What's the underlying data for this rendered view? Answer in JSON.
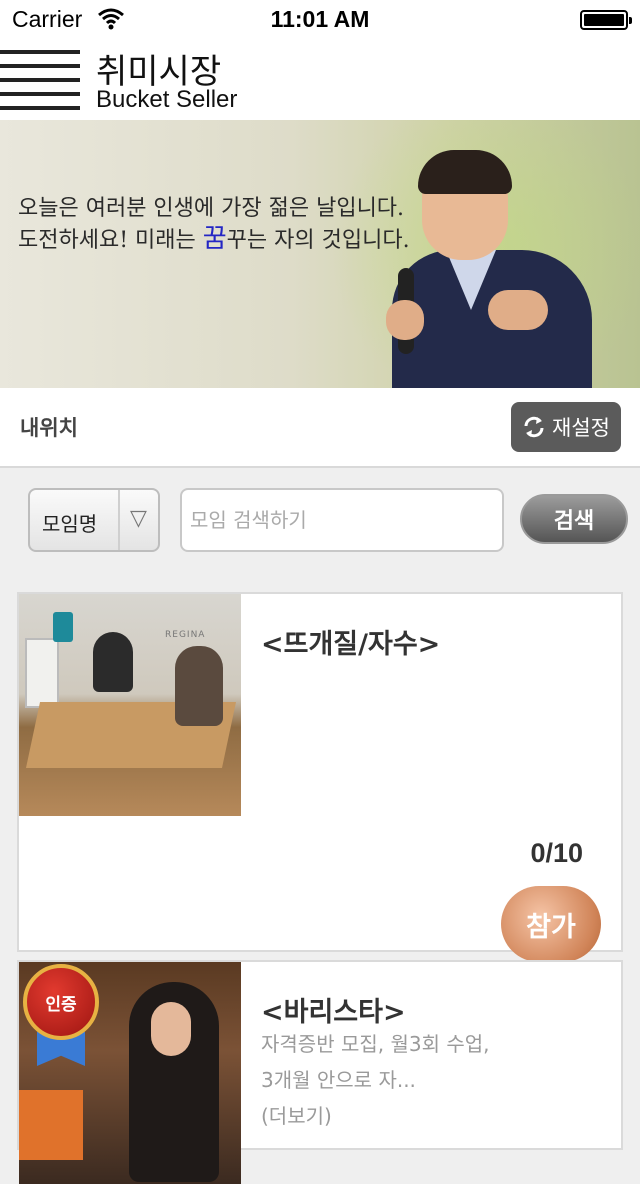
{
  "status_bar": {
    "carrier": "Carrier",
    "time": "11:01 AM"
  },
  "header": {
    "title": "취미시장",
    "subtitle": "Bucket Seller"
  },
  "banner": {
    "quote_line1": "오늘은 여러분 인생에 가장 젊은 날입니다.",
    "quote_line2_before": "도전하세요! 미래는 ",
    "quote_line2_highlight": "꿈",
    "quote_line2_after": "꾸는 자의 것입니다.",
    "pages": 4,
    "active_page": 1
  },
  "location": {
    "label": "내위치",
    "reset_label": "재설정"
  },
  "search": {
    "category": "모임명",
    "placeholder": "모임 검색하기",
    "button_label": "검색"
  },
  "cards": [
    {
      "title": "<뜨개질/자수>",
      "description": "",
      "count": "0/10",
      "join_label": "참가",
      "image_text": "REGINA"
    },
    {
      "title": "<바리스타>",
      "description": "자격증반 모집, 월3회 수업, 3개월 안으로 자...",
      "more": "(더보기)",
      "badge": "인증"
    }
  ],
  "colors": {
    "dot_active": "#1a73e8",
    "dot_inactive": "#c9c9c9",
    "reset_bg": "#5b5b5b"
  }
}
